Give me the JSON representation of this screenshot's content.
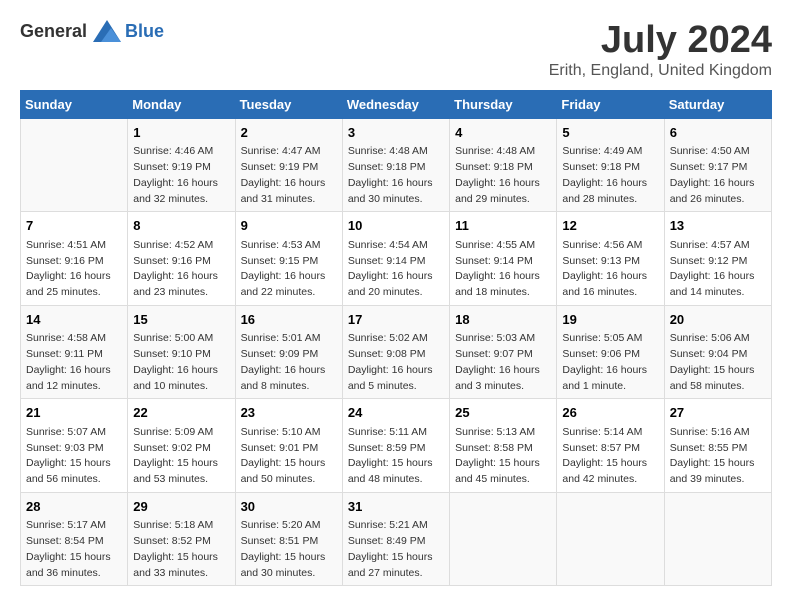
{
  "header": {
    "logo_general": "General",
    "logo_blue": "Blue",
    "title": "July 2024",
    "subtitle": "Erith, England, United Kingdom"
  },
  "calendar": {
    "days_of_week": [
      "Sunday",
      "Monday",
      "Tuesday",
      "Wednesday",
      "Thursday",
      "Friday",
      "Saturday"
    ],
    "weeks": [
      [
        {
          "day": "",
          "content": ""
        },
        {
          "day": "1",
          "content": "Sunrise: 4:46 AM\nSunset: 9:19 PM\nDaylight: 16 hours\nand 32 minutes."
        },
        {
          "day": "2",
          "content": "Sunrise: 4:47 AM\nSunset: 9:19 PM\nDaylight: 16 hours\nand 31 minutes."
        },
        {
          "day": "3",
          "content": "Sunrise: 4:48 AM\nSunset: 9:18 PM\nDaylight: 16 hours\nand 30 minutes."
        },
        {
          "day": "4",
          "content": "Sunrise: 4:48 AM\nSunset: 9:18 PM\nDaylight: 16 hours\nand 29 minutes."
        },
        {
          "day": "5",
          "content": "Sunrise: 4:49 AM\nSunset: 9:18 PM\nDaylight: 16 hours\nand 28 minutes."
        },
        {
          "day": "6",
          "content": "Sunrise: 4:50 AM\nSunset: 9:17 PM\nDaylight: 16 hours\nand 26 minutes."
        }
      ],
      [
        {
          "day": "7",
          "content": "Sunrise: 4:51 AM\nSunset: 9:16 PM\nDaylight: 16 hours\nand 25 minutes."
        },
        {
          "day": "8",
          "content": "Sunrise: 4:52 AM\nSunset: 9:16 PM\nDaylight: 16 hours\nand 23 minutes."
        },
        {
          "day": "9",
          "content": "Sunrise: 4:53 AM\nSunset: 9:15 PM\nDaylight: 16 hours\nand 22 minutes."
        },
        {
          "day": "10",
          "content": "Sunrise: 4:54 AM\nSunset: 9:14 PM\nDaylight: 16 hours\nand 20 minutes."
        },
        {
          "day": "11",
          "content": "Sunrise: 4:55 AM\nSunset: 9:14 PM\nDaylight: 16 hours\nand 18 minutes."
        },
        {
          "day": "12",
          "content": "Sunrise: 4:56 AM\nSunset: 9:13 PM\nDaylight: 16 hours\nand 16 minutes."
        },
        {
          "day": "13",
          "content": "Sunrise: 4:57 AM\nSunset: 9:12 PM\nDaylight: 16 hours\nand 14 minutes."
        }
      ],
      [
        {
          "day": "14",
          "content": "Sunrise: 4:58 AM\nSunset: 9:11 PM\nDaylight: 16 hours\nand 12 minutes."
        },
        {
          "day": "15",
          "content": "Sunrise: 5:00 AM\nSunset: 9:10 PM\nDaylight: 16 hours\nand 10 minutes."
        },
        {
          "day": "16",
          "content": "Sunrise: 5:01 AM\nSunset: 9:09 PM\nDaylight: 16 hours\nand 8 minutes."
        },
        {
          "day": "17",
          "content": "Sunrise: 5:02 AM\nSunset: 9:08 PM\nDaylight: 16 hours\nand 5 minutes."
        },
        {
          "day": "18",
          "content": "Sunrise: 5:03 AM\nSunset: 9:07 PM\nDaylight: 16 hours\nand 3 minutes."
        },
        {
          "day": "19",
          "content": "Sunrise: 5:05 AM\nSunset: 9:06 PM\nDaylight: 16 hours\nand 1 minute."
        },
        {
          "day": "20",
          "content": "Sunrise: 5:06 AM\nSunset: 9:04 PM\nDaylight: 15 hours\nand 58 minutes."
        }
      ],
      [
        {
          "day": "21",
          "content": "Sunrise: 5:07 AM\nSunset: 9:03 PM\nDaylight: 15 hours\nand 56 minutes."
        },
        {
          "day": "22",
          "content": "Sunrise: 5:09 AM\nSunset: 9:02 PM\nDaylight: 15 hours\nand 53 minutes."
        },
        {
          "day": "23",
          "content": "Sunrise: 5:10 AM\nSunset: 9:01 PM\nDaylight: 15 hours\nand 50 minutes."
        },
        {
          "day": "24",
          "content": "Sunrise: 5:11 AM\nSunset: 8:59 PM\nDaylight: 15 hours\nand 48 minutes."
        },
        {
          "day": "25",
          "content": "Sunrise: 5:13 AM\nSunset: 8:58 PM\nDaylight: 15 hours\nand 45 minutes."
        },
        {
          "day": "26",
          "content": "Sunrise: 5:14 AM\nSunset: 8:57 PM\nDaylight: 15 hours\nand 42 minutes."
        },
        {
          "day": "27",
          "content": "Sunrise: 5:16 AM\nSunset: 8:55 PM\nDaylight: 15 hours\nand 39 minutes."
        }
      ],
      [
        {
          "day": "28",
          "content": "Sunrise: 5:17 AM\nSunset: 8:54 PM\nDaylight: 15 hours\nand 36 minutes."
        },
        {
          "day": "29",
          "content": "Sunrise: 5:18 AM\nSunset: 8:52 PM\nDaylight: 15 hours\nand 33 minutes."
        },
        {
          "day": "30",
          "content": "Sunrise: 5:20 AM\nSunset: 8:51 PM\nDaylight: 15 hours\nand 30 minutes."
        },
        {
          "day": "31",
          "content": "Sunrise: 5:21 AM\nSunset: 8:49 PM\nDaylight: 15 hours\nand 27 minutes."
        },
        {
          "day": "",
          "content": ""
        },
        {
          "day": "",
          "content": ""
        },
        {
          "day": "",
          "content": ""
        }
      ]
    ]
  }
}
